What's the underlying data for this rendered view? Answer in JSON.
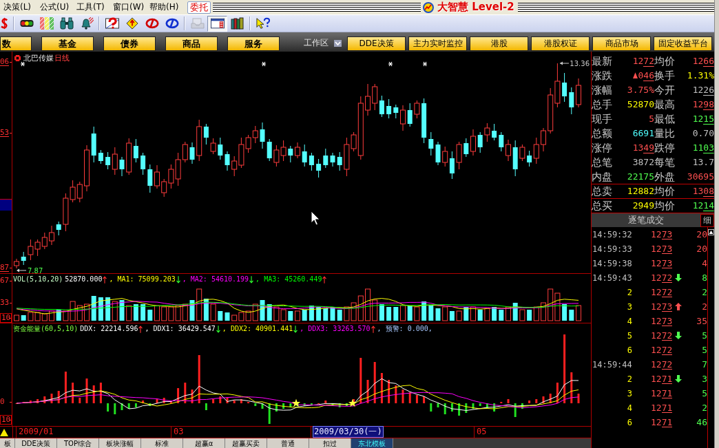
{
  "menu_bar": {
    "items": [
      {
        "label": "决策(L)"
      },
      {
        "label": "公式(U)"
      },
      {
        "label": "工具(T)"
      },
      {
        "label": "窗口(W)"
      },
      {
        "label": "帮助(H)"
      }
    ],
    "trade_button": "委托",
    "brand": "大智慧 Level-2"
  },
  "toolbar": {
    "buttons": [
      {
        "pressed": false,
        "disabled": false
      },
      {
        "pressed": false,
        "disabled": false
      },
      {
        "pressed": false,
        "disabled": false
      },
      {
        "pressed": false,
        "disabled": false
      },
      {
        "pressed": false,
        "disabled": false
      },
      {
        "pressed": false,
        "disabled": false
      },
      {
        "pressed": false,
        "disabled": false
      },
      {
        "pressed": false,
        "disabled": false
      },
      {
        "pressed": false,
        "disabled": false
      },
      {
        "pressed": false,
        "disabled": true
      },
      {
        "pressed": true,
        "disabled": false
      },
      {
        "pressed": false,
        "disabled": false
      },
      {
        "pressed": false,
        "disabled": false
      }
    ]
  },
  "nav_bar": {
    "left_buttons": [
      {
        "label": "数"
      },
      {
        "label": "基金"
      },
      {
        "label": "债券"
      },
      {
        "label": "商品"
      },
      {
        "label": "服务"
      }
    ],
    "workspace": {
      "label": "工作区"
    },
    "right_buttons": [
      {
        "label": "DDE决策"
      },
      {
        "label": "主力实时监控"
      },
      {
        "label": "港股"
      },
      {
        "label": "港股权证"
      },
      {
        "label": "商品市场"
      },
      {
        "label": "固定收益平台"
      }
    ]
  },
  "price_chart": {
    "stock_name": "北巴传媒",
    "period": "日线",
    "axis_labels": [
      {
        "text": "06",
        "boxed": false,
        "decimal_mark": true
      },
      {
        "text": "53",
        "boxed": false,
        "decimal_mark": true
      },
      {
        "text": "87",
        "boxed": false,
        "decimal_mark": true
      }
    ],
    "high_label": "13.36",
    "low_label": "7.87"
  },
  "volume_chart": {
    "axis_labels": [
      {
        "text": "67",
        "boxed": false,
        "decimal_mark": false
      },
      {
        "text": "33",
        "boxed": false,
        "decimal_mark": false
      },
      {
        "text": "10",
        "boxed": true,
        "decimal_mark": false
      }
    ],
    "legend": [
      {
        "text": "VOL(5,10,20)",
        "color": "#c8ffc8",
        "kind": "plain"
      },
      {
        "text": "52870.000",
        "color": "#ffffff",
        "kind": "rising"
      },
      {
        "text": ", MA1: 75099.203",
        "color": "#ffff00",
        "kind": "falling"
      },
      {
        "text": ", MA2: 54610.199",
        "color": "#ff00ff",
        "kind": "falling"
      },
      {
        "text": ", MA3: 45260.449",
        "color": "#00ff00",
        "kind": "rising"
      }
    ]
  },
  "ddx_chart": {
    "axis_labels": [
      {
        "text": "0",
        "boxed": false,
        "decimal_mark": false
      },
      {
        "text": "10",
        "boxed": true,
        "decimal_mark": false
      }
    ],
    "legend": [
      {
        "text": "资金能量(60,5,10)",
        "color": "#80ff40",
        "kind": "plain"
      },
      {
        "text": "DDX: 22214.596",
        "color": "#ffffff",
        "kind": "rising"
      },
      {
        "text": ", DDX1: 36429.547",
        "color": "#ffffff",
        "kind": "falling"
      },
      {
        "text": ", DDX2: 40901.441",
        "color": "#ffff00",
        "kind": "falling"
      },
      {
        "text": ", DDX3: 33263.570",
        "color": "#ff00ff",
        "kind": "rising"
      },
      {
        "text": ", 预警: 0.000,",
        "color": "#a8c8ff",
        "kind": "plain"
      }
    ]
  },
  "date_axis": {
    "labels": [
      {
        "text": "2009/01",
        "highlighted": false
      },
      {
        "text": "03",
        "highlighted": false
      },
      {
        "text": "2009/03/30(一)",
        "highlighted": true
      },
      {
        "text": "05",
        "highlighted": false
      }
    ]
  },
  "bottom_tabs": [
    {
      "label": "板",
      "selected": false
    },
    {
      "label": "DDE决策",
      "selected": false
    },
    {
      "label": "TOP综合",
      "selected": false
    },
    {
      "label": "板块涨幅",
      "selected": false
    },
    {
      "label": "标准",
      "selected": false
    },
    {
      "label": "超赢α",
      "selected": false
    },
    {
      "label": "超赢买卖",
      "selected": false
    },
    {
      "label": "普通",
      "selected": false
    },
    {
      "label": "扣过",
      "selected": false
    },
    {
      "label": "东北模板",
      "selected": true
    }
  ],
  "quote_panel": {
    "rows": [
      {
        "cells": [
          {
            "label": "最新",
            "value": "1272",
            "color": "#ff5050",
            "decimal_mark": true,
            "kind": "plain"
          },
          {
            "label": "均价",
            "value": "1266",
            "color": "#ff5050",
            "decimal_mark": true,
            "kind": "plain"
          }
        ]
      },
      {
        "cells": [
          {
            "label": "涨跌",
            "value": "046",
            "color": "#ff5050",
            "decimal_mark": true,
            "kind": "rising"
          },
          {
            "label": "换手",
            "value": "1.31%",
            "color": "#ffff00",
            "decimal_mark": false,
            "kind": "plain"
          }
        ]
      },
      {
        "cells": [
          {
            "label": "涨幅",
            "value": "3.75%",
            "color": "#ff5050",
            "decimal_mark": false,
            "kind": "plain"
          },
          {
            "label": "今开",
            "value": "1226",
            "color": "#c0c0c0",
            "decimal_mark": true,
            "kind": "plain"
          }
        ]
      },
      {
        "cells": [
          {
            "label": "总手",
            "value": "52870",
            "color": "#ffff00",
            "decimal_mark": false,
            "kind": "plain"
          },
          {
            "label": "最高",
            "value": "1298",
            "color": "#ff5050",
            "decimal_mark": true,
            "kind": "plain"
          }
        ]
      },
      {
        "cells": [
          {
            "label": "现手",
            "value": "5",
            "color": "#ff5050",
            "decimal_mark": false,
            "kind": "plain"
          },
          {
            "label": "最低",
            "value": "1215",
            "color": "#50ff50",
            "decimal_mark": true,
            "kind": "plain"
          }
        ]
      },
      {
        "cells": [
          {
            "label": "总额",
            "value": "6691",
            "color": "#50ffff",
            "decimal_mark": false,
            "kind": "plain"
          },
          {
            "label": "量比",
            "value": "0.70",
            "color": "#c0c0c0",
            "decimal_mark": false,
            "kind": "plain"
          }
        ]
      },
      {
        "cells": [
          {
            "label": "涨停",
            "value": "1349",
            "color": "#ff5050",
            "decimal_mark": true,
            "kind": "plain"
          },
          {
            "label": "跌停",
            "value": "1103",
            "color": "#50ff50",
            "decimal_mark": true,
            "kind": "plain"
          }
        ]
      },
      {
        "cells": [
          {
            "label": "总笔",
            "value": "3872",
            "color": "#c0c0c0",
            "decimal_mark": false,
            "kind": "plain"
          },
          {
            "label": "每笔",
            "value": "13.7",
            "color": "#c0c0c0",
            "decimal_mark": false,
            "kind": "plain"
          }
        ]
      },
      {
        "cells": [
          {
            "label": "内盘",
            "value": "22175",
            "color": "#50ff50",
            "decimal_mark": false,
            "kind": "plain"
          },
          {
            "label": "外盘",
            "value": "30695",
            "color": "#ff5050",
            "decimal_mark": false,
            "kind": "plain"
          }
        ]
      }
    ],
    "totals": [
      {
        "cells": [
          {
            "label": "总卖",
            "value": "12882",
            "color": "#ffff00",
            "decimal_mark": false
          },
          {
            "label": "均价",
            "value": "1308",
            "color": "#ff5050",
            "decimal_mark": true
          }
        ]
      },
      {
        "cells": [
          {
            "label": "总买",
            "value": "2949",
            "color": "#ffff00",
            "decimal_mark": false
          },
          {
            "label": "均价",
            "value": "1214",
            "color": "#50ff50",
            "decimal_mark": true
          }
        ]
      }
    ],
    "trades_title": "逐笔成交",
    "detail_button": "细",
    "trades": [
      {
        "time": "14:59:32",
        "continued": false,
        "price": "1273",
        "kind": "plain",
        "volume": "20",
        "buy": true
      },
      {
        "time": "14:59:33",
        "continued": false,
        "price": "1273",
        "kind": "plain",
        "volume": "20",
        "buy": true
      },
      {
        "time": "14:59:38",
        "continued": false,
        "price": "1273",
        "kind": "plain",
        "volume": "4",
        "buy": true
      },
      {
        "time": "14:59:43",
        "continued": false,
        "price": "1272",
        "kind": "downtick",
        "volume": "8",
        "buy": false
      },
      {
        "time": "2",
        "continued": true,
        "price": "1272",
        "kind": "plain",
        "volume": "2",
        "buy": false
      },
      {
        "time": "3",
        "continued": true,
        "price": "1273",
        "kind": "uptick",
        "volume": "2",
        "buy": true
      },
      {
        "time": "4",
        "continued": true,
        "price": "1273",
        "kind": "plain",
        "volume": "35",
        "buy": true
      },
      {
        "time": "5",
        "continued": true,
        "price": "1272",
        "kind": "downtick",
        "volume": "5",
        "buy": false
      },
      {
        "time": "6",
        "continued": true,
        "price": "1272",
        "kind": "plain",
        "volume": "5",
        "buy": false
      },
      {
        "time": "14:59:44",
        "continued": false,
        "price": "1272",
        "kind": "plain",
        "volume": "7",
        "buy": false
      },
      {
        "time": "2",
        "continued": true,
        "price": "1271",
        "kind": "downtick",
        "volume": "3",
        "buy": false
      },
      {
        "time": "3",
        "continued": true,
        "price": "1271",
        "kind": "plain",
        "volume": "5",
        "buy": false
      },
      {
        "time": "4",
        "continued": true,
        "price": "1271",
        "kind": "plain",
        "volume": "2",
        "buy": false
      },
      {
        "time": "6",
        "continued": true,
        "price": "1271",
        "kind": "plain",
        "volume": "46",
        "buy": false
      }
    ]
  }
}
